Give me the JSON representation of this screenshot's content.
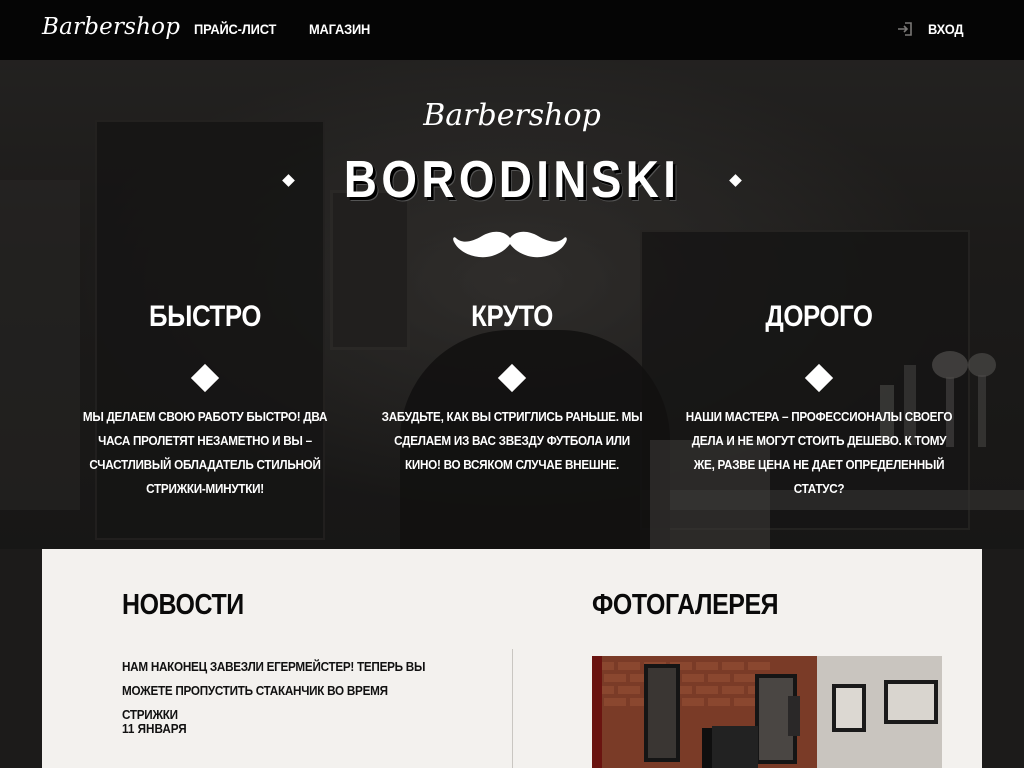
{
  "header": {
    "logo": "Barbershop",
    "nav": [
      "ПРАЙС-ЛИСТ",
      "МАГАЗИН"
    ],
    "login_label": "ВХОД",
    "login_icon": "login-icon"
  },
  "hero": {
    "subtitle": "Barbershop",
    "title": "BORODINSKI",
    "mustache_icon": "mustache-icon",
    "features": [
      {
        "title": "БЫСТРО",
        "text": "МЫ ДЕЛАЕМ СВОЮ РАБОТУ БЫСТРО! ДВА ЧАСА ПРОЛЕТЯТ НЕЗАМЕТНО И ВЫ – СЧАСТЛИВЫЙ ОБЛАДАТЕЛЬ СТИЛЬНОЙ СТРИЖКИ-МИНУТКИ!"
      },
      {
        "title": "КРУТО",
        "text": "ЗАБУДЬТЕ, КАК ВЫ СТРИГЛИСЬ РАНЬШЕ. МЫ СДЕЛАЕМ ИЗ ВАС ЗВЕЗДУ ФУТБОЛА ИЛИ КИНО! ВО ВСЯКОМ СЛУЧАЕ ВНЕШНЕ."
      },
      {
        "title": "ДОРОГО",
        "text": "НАШИ МАСТЕРА – ПРОФЕССИОНАЛЫ СВОЕГО ДЕЛА И НЕ МОГУТ СТОИТЬ ДЕШЕВО. К ТОМУ ЖЕ, РАЗВЕ ЦЕНА НЕ ДАЕТ ОПРЕДЕЛЕННЫЙ СТАТУС?"
      }
    ]
  },
  "news": {
    "title": "НОВОСТИ",
    "items": [
      {
        "text": "НАМ НАКОНЕЦ ЗАВЕЗЛИ ЕГЕРМЕЙСТЕР! ТЕПЕРЬ ВЫ МОЖЕТЕ ПРОПУСТИТЬ СТАКАНЧИК ВО ВРЕМЯ СТРИЖКИ",
        "date": "11 ЯНВАРЯ"
      }
    ]
  },
  "gallery": {
    "title": "ФОТОГАЛЕРЕЯ"
  },
  "colors": {
    "topbar": "#050505",
    "panel": "#f3f1ee",
    "text_dark": "#111111",
    "text_light": "#ffffff"
  }
}
